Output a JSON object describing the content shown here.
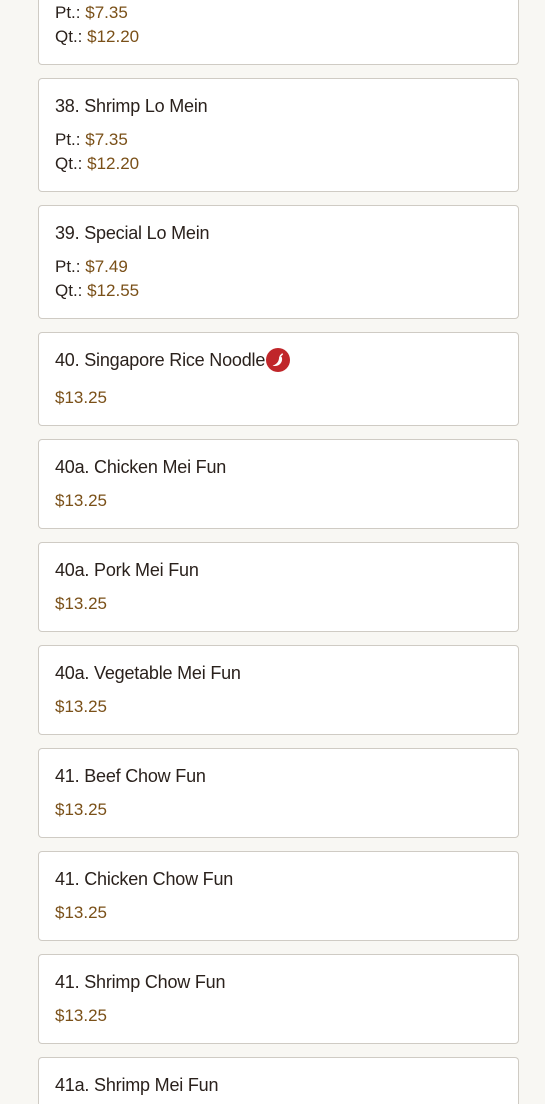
{
  "theme": {
    "background": "#f8f7f3",
    "card_background": "#ffffff",
    "card_border": "#cfcbc4",
    "title_color": "#2a211c",
    "price_color": "#7a5018",
    "spicy_badge_color": "#c0262a"
  },
  "menu": {
    "items": [
      {
        "title": "",
        "spicy": false,
        "prices": [
          {
            "label": "Pt.: ",
            "value": "$7.35"
          },
          {
            "label": "Qt.: ",
            "value": "$12.20"
          }
        ]
      },
      {
        "title": "38. Shrimp Lo Mein",
        "spicy": false,
        "prices": [
          {
            "label": "Pt.: ",
            "value": "$7.35"
          },
          {
            "label": "Qt.: ",
            "value": "$12.20"
          }
        ]
      },
      {
        "title": "39. Special Lo Mein",
        "spicy": false,
        "prices": [
          {
            "label": "Pt.: ",
            "value": "$7.49"
          },
          {
            "label": "Qt.: ",
            "value": "$12.55"
          }
        ]
      },
      {
        "title": "40. Singapore Rice Noodle",
        "spicy": true,
        "spicy_icon": "chili-pepper-icon",
        "prices": [
          {
            "label": "",
            "value": "$13.25"
          }
        ]
      },
      {
        "title": "40a. Chicken Mei Fun",
        "spicy": false,
        "prices": [
          {
            "label": "",
            "value": "$13.25"
          }
        ]
      },
      {
        "title": "40a. Pork Mei Fun",
        "spicy": false,
        "prices": [
          {
            "label": "",
            "value": "$13.25"
          }
        ]
      },
      {
        "title": "40a. Vegetable Mei Fun",
        "spicy": false,
        "prices": [
          {
            "label": "",
            "value": "$13.25"
          }
        ]
      },
      {
        "title": "41. Beef Chow Fun",
        "spicy": false,
        "prices": [
          {
            "label": "",
            "value": "$13.25"
          }
        ]
      },
      {
        "title": "41. Chicken Chow Fun",
        "spicy": false,
        "prices": [
          {
            "label": "",
            "value": "$13.25"
          }
        ]
      },
      {
        "title": "41. Shrimp Chow Fun",
        "spicy": false,
        "prices": [
          {
            "label": "",
            "value": "$13.25"
          }
        ]
      },
      {
        "title": "41a. Shrimp Mei Fun",
        "spicy": false,
        "prices": []
      }
    ]
  }
}
